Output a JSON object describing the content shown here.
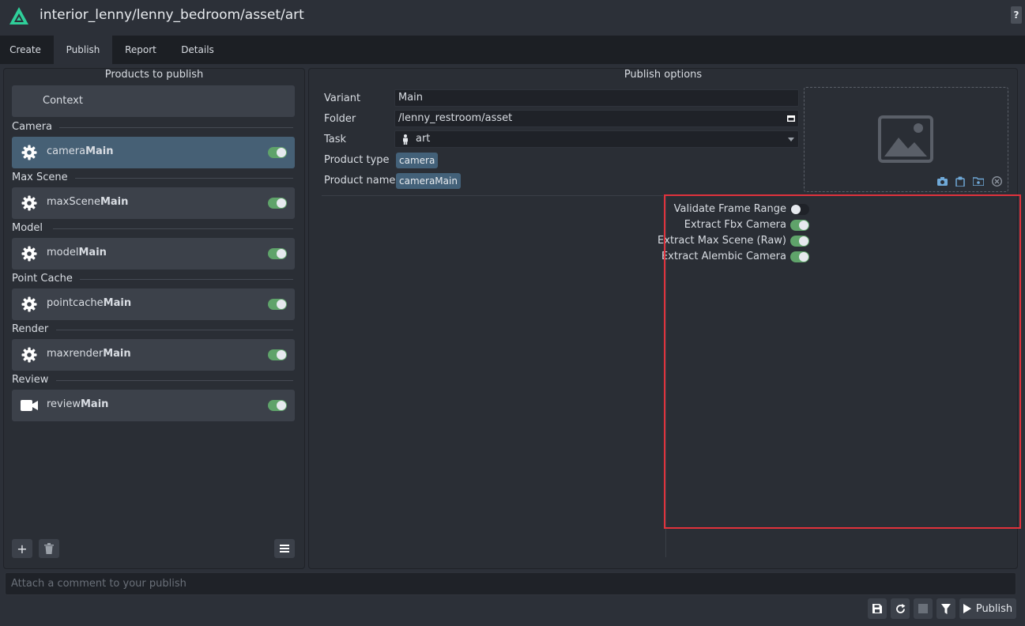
{
  "window": {
    "title": "interior_lenny/lenny_bedroom/asset/art",
    "help_label": "?"
  },
  "tabs": [
    {
      "label": "Create"
    },
    {
      "label": "Publish",
      "active": true
    },
    {
      "label": "Report"
    },
    {
      "label": "Details"
    }
  ],
  "products": {
    "title": "Products to publish",
    "context_label": "Context",
    "groups": [
      {
        "label": "Camera",
        "item_prefix": "camera",
        "item_bold": "Main",
        "icon": "gear-icon",
        "enabled": true,
        "selected": true
      },
      {
        "label": "Max Scene",
        "item_prefix": "maxScene",
        "item_bold": "Main",
        "icon": "gear-icon",
        "enabled": true
      },
      {
        "label": "Model",
        "item_prefix": "model",
        "item_bold": "Main",
        "icon": "gear-icon",
        "enabled": true
      },
      {
        "label": "Point Cache",
        "item_prefix": "pointcache",
        "item_bold": "Main",
        "icon": "gear-icon",
        "enabled": true
      },
      {
        "label": "Render",
        "item_prefix": "maxrender",
        "item_bold": "Main",
        "icon": "gear-icon",
        "enabled": true
      },
      {
        "label": "Review",
        "item_prefix": "review",
        "item_bold": "Main",
        "icon": "video-camera-icon",
        "enabled": true
      }
    ],
    "buttons": {
      "add": "+",
      "delete_icon": "trash-icon",
      "menu_icon": "hamburger-menu-icon"
    }
  },
  "options": {
    "title": "Publish options",
    "variant_label": "Variant",
    "variant_value": "Main",
    "folder_label": "Folder",
    "folder_value": "/lenny_restroom/asset",
    "task_label": "Task",
    "task_value": "art",
    "product_type_label": "Product type",
    "product_type_value": "camera",
    "product_name_label": "Product name",
    "product_name_value": "cameraMain",
    "attributes": [
      {
        "label": "Validate Frame Range",
        "enabled": false
      },
      {
        "label": "Extract Fbx Camera",
        "enabled": true
      },
      {
        "label": "Extract Max Scene (Raw)",
        "enabled": true
      },
      {
        "label": "Extract Alembic Camera",
        "enabled": true
      }
    ]
  },
  "comment": {
    "placeholder": "Attach a comment to your publish"
  },
  "actions": {
    "publish_label": "Publish"
  },
  "colors": {
    "accent_toggle": "#5fa36a",
    "selected_row": "#466075",
    "highlight": "#e0323c"
  }
}
